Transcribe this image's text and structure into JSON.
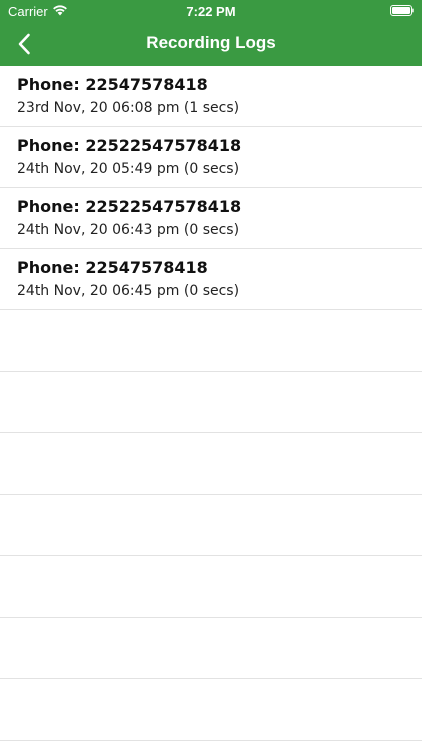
{
  "status_bar": {
    "carrier": "Carrier",
    "time": "7:22 PM",
    "wifi_icon": "wifi-icon",
    "battery_icon": "battery-icon"
  },
  "nav": {
    "title": "Recording Logs",
    "back_icon": "chevron-left-icon"
  },
  "colors": {
    "header_bg": "#3a9a42",
    "header_text": "#ffffff",
    "separator": "#e2e2e2"
  },
  "logs": [
    {
      "phone": "Phone: 22547578418",
      "date": "23rd Nov, 20 06:08 pm (1 secs)"
    },
    {
      "phone": "Phone: 22522547578418",
      "date": "24th Nov, 20 05:49 pm (0 secs)"
    },
    {
      "phone": "Phone: 22522547578418",
      "date": "24th Nov, 20 06:43 pm (0 secs)"
    },
    {
      "phone": "Phone: 22547578418",
      "date": "24th Nov, 20 06:45 pm (0 secs)"
    }
  ]
}
